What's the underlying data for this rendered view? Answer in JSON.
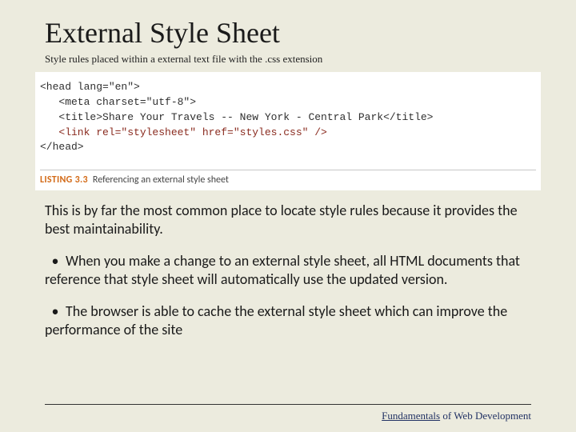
{
  "title": "External Style Sheet",
  "subtitle": "Style rules placed within a external text file with the .css extension",
  "code": {
    "line1": "<head lang=\"en\">",
    "line2": "   <meta charset=\"utf-8\">",
    "line3": "   <title>Share Your Travels -- New York - Central Park</title>",
    "line4": "   <link rel=\"stylesheet\" href=\"styles.css\" />",
    "line5": "</head>"
  },
  "listing": {
    "num": "LISTING 3.3",
    "caption": "Referencing an external style sheet"
  },
  "intro": "This is by far the most common place to locate style rules because it provides the best maintainability.",
  "bullets": [
    "When you make a change to an external style sheet, all HTML documents that reference that style sheet will automatically use the updated version.",
    "The browser is able to cache the external style sheet which can improve the performance of the site"
  ],
  "footer": {
    "word1": "Fundamentals",
    "word2": " of Web Development"
  }
}
